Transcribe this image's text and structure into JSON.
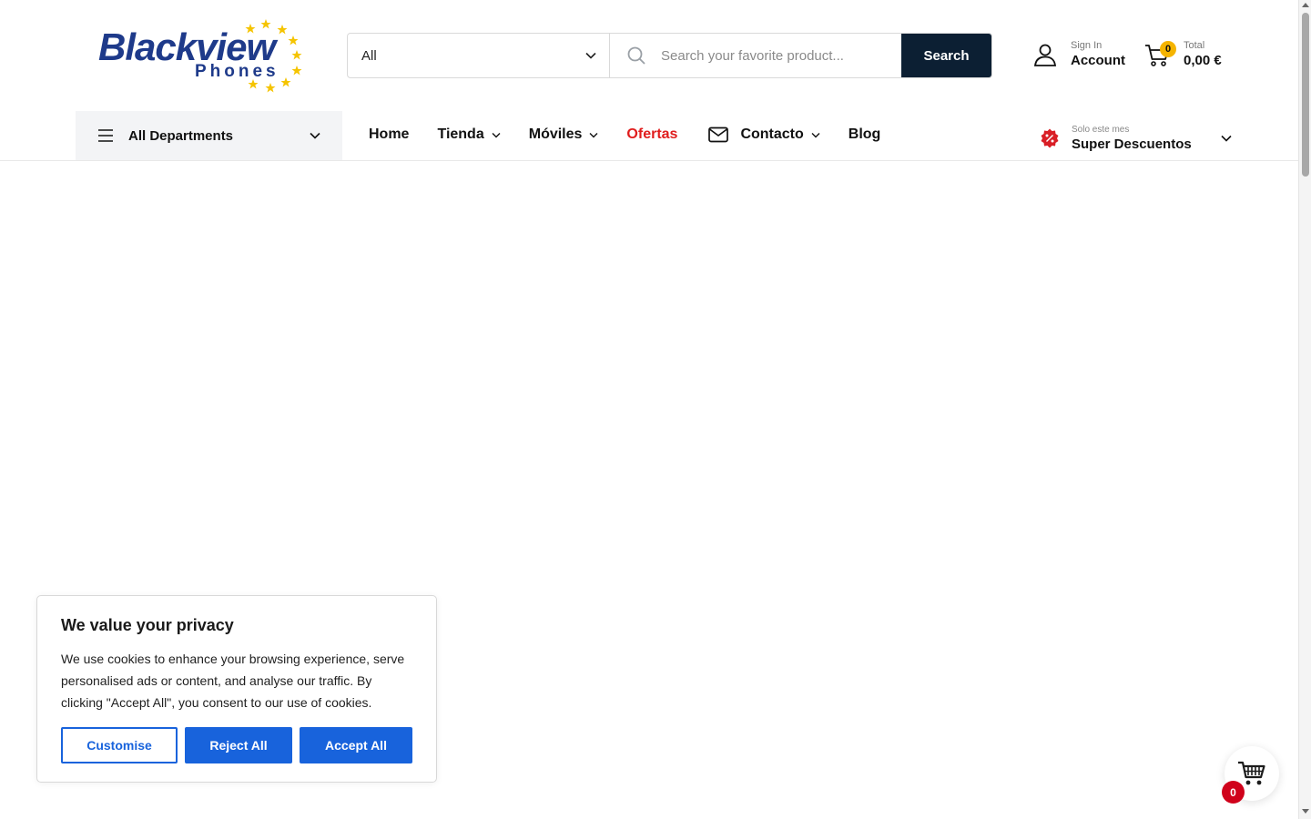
{
  "brand": {
    "name": "Blackview",
    "sub": "Phones",
    "primary_color": "#1e3a8a",
    "star_color": "#f5c400"
  },
  "search": {
    "category_selected": "All",
    "placeholder": "Search your favorite product...",
    "button_label": "Search",
    "button_color": "#0c1f33"
  },
  "account": {
    "small": "Sign In",
    "label": "Account"
  },
  "cart": {
    "count": "0",
    "small": "Total",
    "total": "0,00 €"
  },
  "nav": {
    "departments_label": "All Departments",
    "items": [
      {
        "label": "Home"
      },
      {
        "label": "Tienda"
      },
      {
        "label": "Móviles"
      },
      {
        "label": "Ofertas",
        "color": "#e01d1d"
      },
      {
        "label": "Contacto"
      },
      {
        "label": "Blog"
      }
    ],
    "promo_small": "Solo este mes",
    "promo_label": "Super Descuentos"
  },
  "cookie": {
    "title": "We value your privacy",
    "body": "We use cookies to enhance your browsing experience, serve personalised ads or content, and analyse our traffic. By clicking \"Accept All\", you consent to our use of cookies.",
    "customise": "Customise",
    "reject": "Reject All",
    "accept": "Accept All",
    "accent_color": "#1863dc"
  },
  "floating_cart": {
    "count": "0",
    "badge_color": "#d0021b"
  },
  "icons": [
    "chevron-down-icon",
    "search-icon",
    "user-icon",
    "cart-icon",
    "hamburger-icon",
    "mail-icon",
    "discount-icon",
    "star-icon"
  ]
}
